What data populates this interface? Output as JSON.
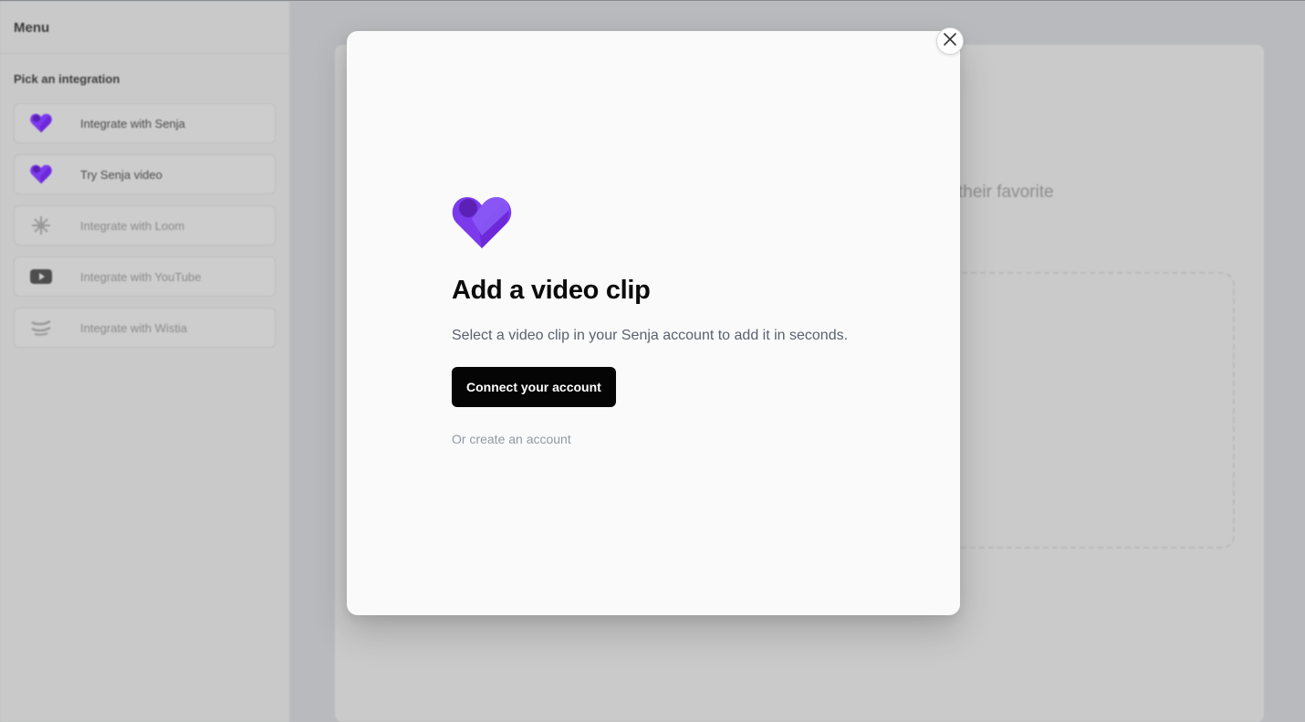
{
  "sidebar": {
    "title": "Menu",
    "section_label": "Pick an integration",
    "items": [
      {
        "label": "Integrate with Senja",
        "icon": "senja-heart-icon"
      },
      {
        "label": "Try Senja video",
        "icon": "senja-heart-icon"
      },
      {
        "label": "Integrate with Loom",
        "icon": "loom-icon"
      },
      {
        "label": "Integrate with YouTube",
        "icon": "youtube-icon"
      },
      {
        "label": "Integrate with Wistia",
        "icon": "wistia-icon"
      }
    ]
  },
  "background": {
    "partial_text": "their favorite"
  },
  "modal": {
    "logo_icon": "senja-heart-icon",
    "title": "Add a video clip",
    "description": "Select a video clip in your Senja account to add it in seconds.",
    "primary_button": "Connect your account",
    "secondary_link": "Or create an account",
    "close_icon": "close-icon"
  },
  "colors": {
    "brand_purple": "#7c3aed",
    "brand_purple_dark": "#6d28d9",
    "primary_button_bg": "#050505"
  }
}
